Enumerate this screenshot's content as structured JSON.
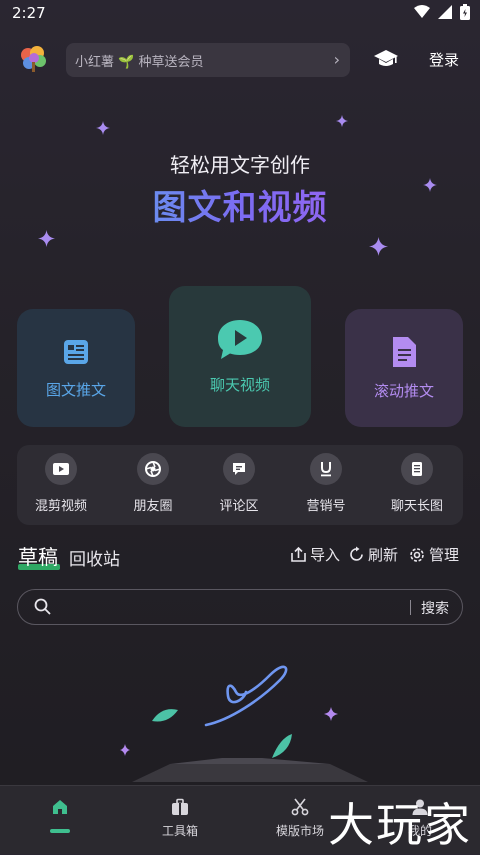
{
  "status": {
    "time": "2:27"
  },
  "topbar": {
    "promo_text": "小红薯 🌱 种草送会员",
    "login_label": "登录"
  },
  "hero": {
    "subtitle": "轻松用文字创作",
    "title": "图文和视频"
  },
  "cards": [
    {
      "label": "图文推文",
      "color": "#5aa6e8"
    },
    {
      "label": "聊天视频",
      "color": "#4bc9b0"
    },
    {
      "label": "滚动推文",
      "color": "#b38cf0"
    }
  ],
  "tools": [
    {
      "label": "混剪视频",
      "icon": "play-film-icon"
    },
    {
      "label": "朋友圈",
      "icon": "aperture-icon"
    },
    {
      "label": "评论区",
      "icon": "comment-icon"
    },
    {
      "label": "营销号",
      "icon": "underline-u-icon"
    },
    {
      "label": "聊天长图",
      "icon": "phone-list-icon"
    }
  ],
  "drafts": {
    "active_tab": "草稿",
    "other_tab": "回收站",
    "import_label": "导入",
    "refresh_label": "刷新",
    "manage_label": "管理",
    "search_placeholder": "",
    "search_button": "搜索"
  },
  "bottomnav": [
    {
      "label": "",
      "icon": "home-icon"
    },
    {
      "label": "工具箱",
      "icon": "toolbox-icon"
    },
    {
      "label": "模版市场",
      "icon": "scissors-icon"
    },
    {
      "label": "我的",
      "icon": "user-icon"
    }
  ],
  "watermark": "大玩家",
  "colors": {
    "accent_green": "#2fa864",
    "nav_indicator": "#3fbf8f"
  }
}
